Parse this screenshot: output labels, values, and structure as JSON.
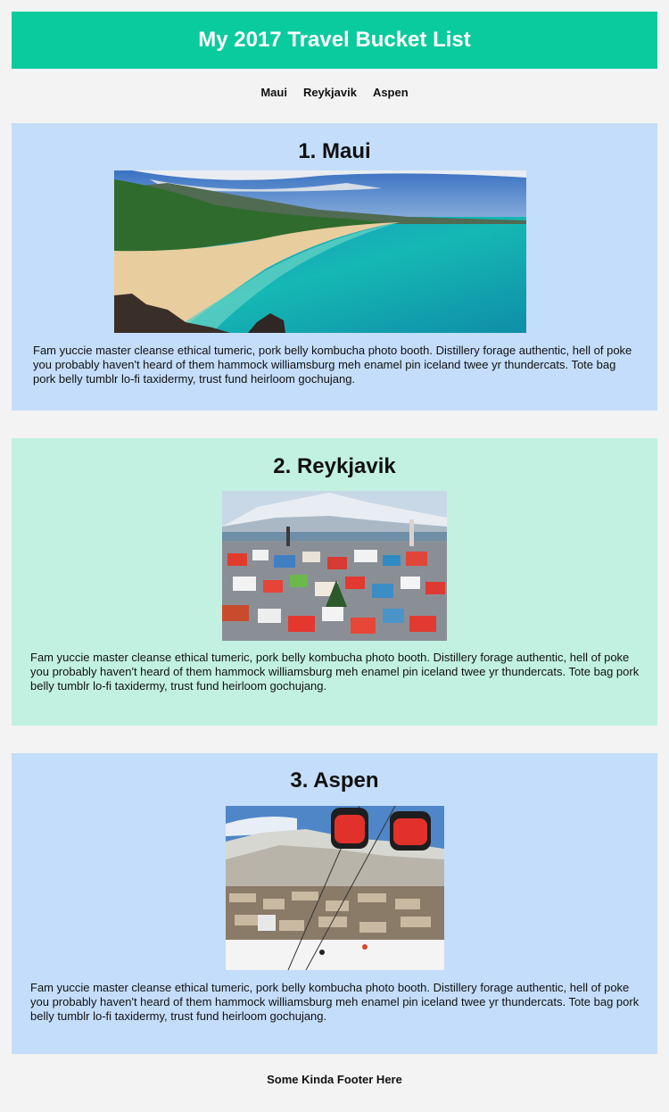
{
  "header": {
    "title": "My 2017 Travel Bucket List"
  },
  "nav": {
    "items": [
      "Maui",
      "Reykjavik",
      "Aspen"
    ]
  },
  "sections": [
    {
      "heading": "1. Maui",
      "image_icon": "beach-photo",
      "body": "Fam yuccie master cleanse ethical tumeric, pork belly kombucha photo booth. Distillery forage authentic, hell of poke you probably haven't heard of them hammock williamsburg meh enamel pin iceland twee yr thundercats. Tote bag pork belly tumblr lo-fi taxidermy, trust fund heirloom gochujang."
    },
    {
      "heading": "2. Reykjavik",
      "image_icon": "city-photo",
      "body": "Fam yuccie master cleanse ethical tumeric, pork belly kombucha photo booth. Distillery forage authentic, hell of poke you probably haven't heard of them hammock williamsburg meh enamel pin iceland twee yr thundercats. Tote bag pork belly tumblr lo-fi taxidermy, trust fund heirloom gochujang."
    },
    {
      "heading": "3. Aspen",
      "image_icon": "ski-town-photo",
      "body": "Fam yuccie master cleanse ethical tumeric, pork belly kombucha photo booth. Distillery forage authentic, hell of poke you probably haven't heard of them hammock williamsburg meh enamel pin iceland twee yr thundercats. Tote bag pork belly tumblr lo-fi taxidermy, trust fund heirloom gochujang."
    }
  ],
  "footer": {
    "text": "Some Kinda Footer Here"
  },
  "colors": {
    "header_bg": "#0acb9d",
    "section_blue": "#c4ddfa",
    "section_green": "#c2f1e1",
    "page_bg": "#f3f3f3"
  }
}
